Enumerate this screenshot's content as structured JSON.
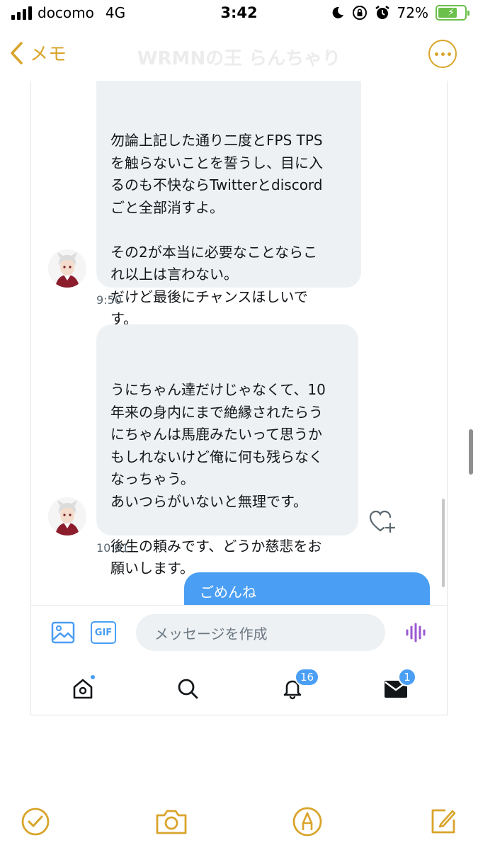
{
  "status_bar": {
    "carrier": "docomo",
    "network": "4G",
    "time": "3:42",
    "battery_percent": "72%",
    "battery_level": 0.72
  },
  "notes_nav": {
    "back_label": "メモ",
    "background_title": "WRMNの王 らんちゃり"
  },
  "messages": [
    {
      "sender": "other",
      "text": "勿論上記した通り二度とFPS TPS\nを触らないことを誓うし、目に入\nるのも不快ならTwitterとdiscord\nごと全部消すよ。\n\nその2が本当に必要なことならこ\nれ以上は言わない。\nだけど最後にチャンスほしいで\nす。",
      "time": "9:50"
    },
    {
      "sender": "other",
      "text": "うにちゃん達だけじゃなくて、10\n年来の身内にまで絶縁されたらう\nにちゃんは馬鹿みたいって思うか\nもしれないけど俺に何も残らなく\nなっちゃう。\nあいつらがいないと無理です。\n\n後生の頼みです、どうか慈悲をお\n願いします。",
      "time": "10:01"
    },
    {
      "sender": "self",
      "text": "ごめんね"
    }
  ],
  "composer": {
    "placeholder": "メッセージを作成",
    "gif_label": "GIF"
  },
  "tabbar": {
    "notifications_badge": "16",
    "messages_badge": "1"
  },
  "colors": {
    "notes_accent": "#d9a42b",
    "twitter_blue": "#4a9ef3",
    "bubble_gray": "#eef1f3",
    "voice_purple": "#9b59d0"
  },
  "icons": {
    "back": "chevron-left-icon",
    "more": "ellipsis-circle-icon",
    "image": "image-icon",
    "voice": "waveform-icon",
    "home": "home-icon",
    "search": "search-icon",
    "notifications": "bell-icon",
    "messages": "envelope-icon",
    "like": "heart-plus-icon",
    "done": "checkmark-circle-icon",
    "camera": "camera-icon",
    "markup": "pen-circle-icon",
    "compose": "compose-icon"
  }
}
